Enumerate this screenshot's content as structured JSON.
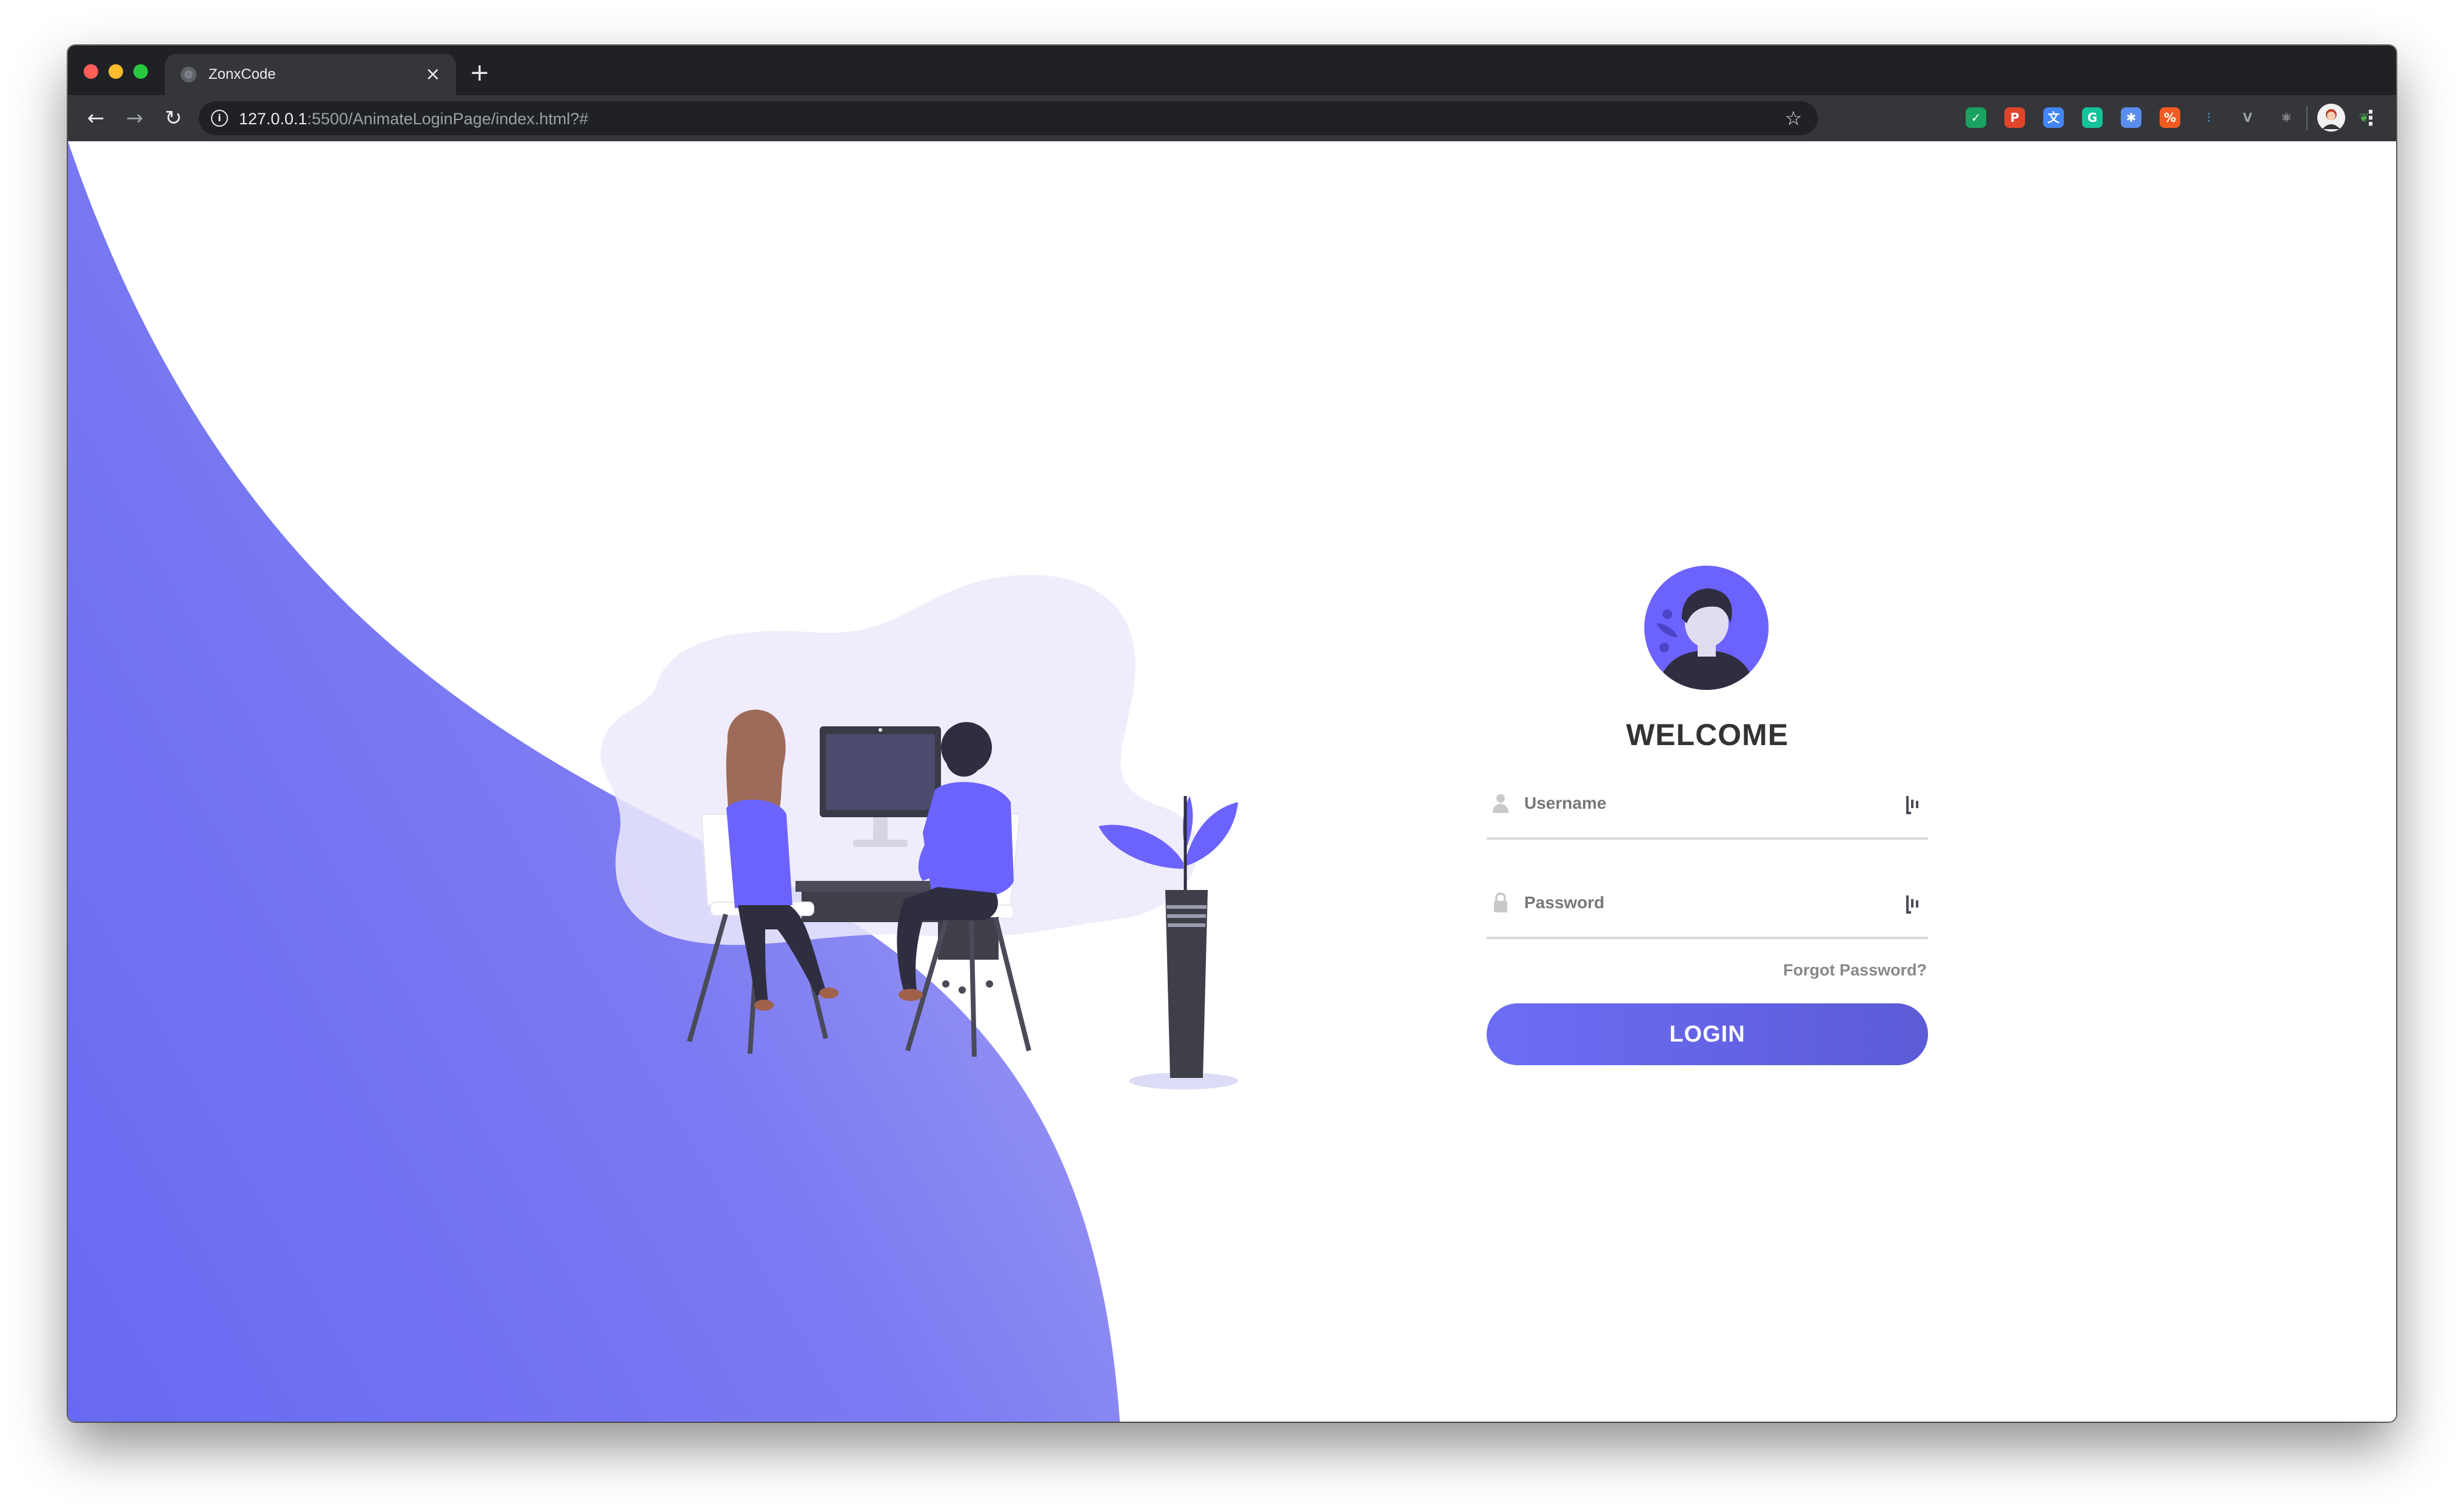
{
  "browser": {
    "tab_title": "ZonxCode",
    "tab_close": "×",
    "new_tab": "+",
    "url_host": "127.0.0.1",
    "url_rest": ":5500/AnimateLoginPage/index.html?#",
    "back_icon": "←",
    "forward_icon": "→",
    "reload_icon": "↻",
    "info_icon": "i",
    "star_icon": "☆",
    "menu_icon": "⋮",
    "extensions": [
      {
        "name": "ublock-icon",
        "glyph": "✓",
        "color": "#1aa260"
      },
      {
        "name": "pinterest-icon",
        "glyph": "P",
        "color": "#e0452b"
      },
      {
        "name": "translate-icon",
        "glyph": "文",
        "color": "#4285f4"
      },
      {
        "name": "grammarly-icon",
        "glyph": "G",
        "color": "#15c39a"
      },
      {
        "name": "asterisk-icon",
        "glyph": "✱",
        "color": "#5b8def"
      },
      {
        "name": "percent-icon",
        "glyph": "%",
        "color": "#f25c23"
      },
      {
        "name": "bars-icon",
        "glyph": "⫶",
        "color": "#4e8ab8"
      },
      {
        "name": "vue-icon",
        "glyph": "V",
        "color": "#9aa0a6"
      },
      {
        "name": "react-icon",
        "glyph": "⚛",
        "color": "#e8eaed"
      },
      {
        "name": "flag-icon",
        "glyph": "⚑",
        "color": "#e8eaed"
      },
      {
        "name": "leaf-icon",
        "glyph": "❦",
        "color": "#4caf50"
      },
      {
        "name": "recycle-icon",
        "glyph": "♺",
        "color": "#6b6f73"
      }
    ]
  },
  "colors": {
    "accent": "#6c63ff",
    "wave_start": "#6769f2",
    "wave_end": "#9b98f2"
  },
  "login": {
    "welcome": "WELCOME",
    "username_placeholder": "Username",
    "password_placeholder": "Password",
    "forgot": "Forgot Password?",
    "button": "LOGIN"
  }
}
